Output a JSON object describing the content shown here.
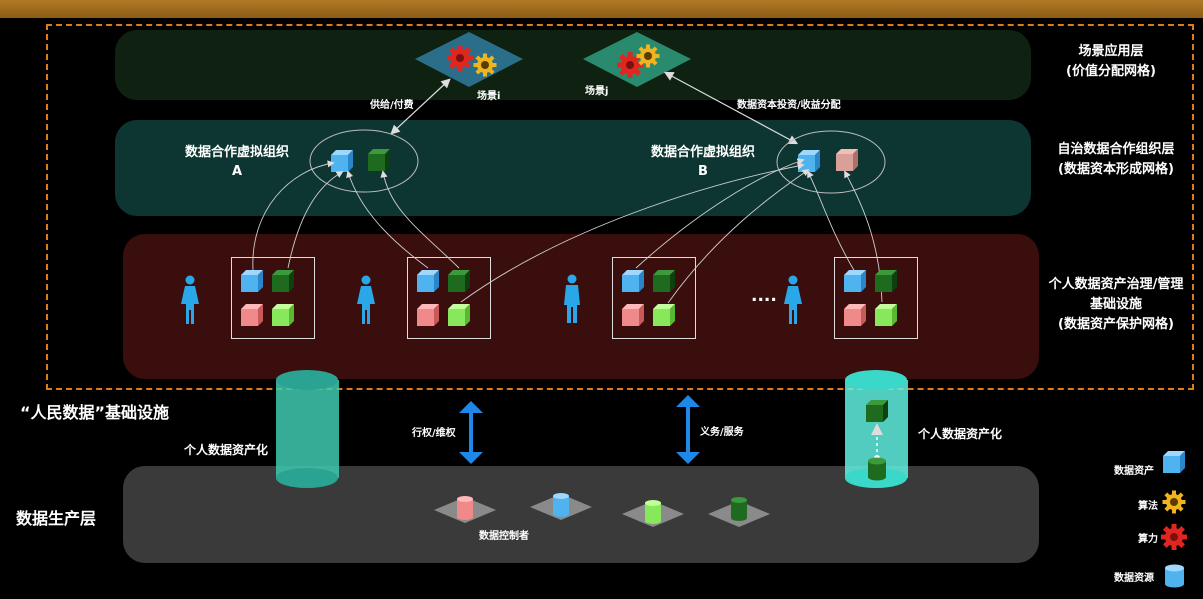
{
  "layers": {
    "scene": {
      "line1": "场景应用层",
      "line2": "(价值分配网格)"
    },
    "org": {
      "line1": "自治数据合作组织层",
      "line2": "(数据资本形成网格)"
    },
    "infra": {
      "line1": "个人数据资产治理/管理",
      "line2": "基础设施",
      "line3": "(数据资产保护网格)"
    }
  },
  "scenes": {
    "scene_i": "场景i",
    "scene_j": "场景j"
  },
  "org_a": {
    "line1": "数据合作虚拟组织",
    "line2": "A"
  },
  "org_b": {
    "line1": "数据合作虚拟组织",
    "line2": "B"
  },
  "flows": {
    "supply_pay": "供给/付费",
    "invest_share": "数据资本投资/收益分配",
    "right_protect": "行权/维权",
    "duty_service": "义务/服务"
  },
  "infra_title": "“人民数据”基础设施",
  "ellipsis": "....",
  "assetization_left": "个人数据资产化",
  "assetization_right": "个人数据资产化",
  "production": {
    "title": "数据生产层",
    "controller": "数据控制者"
  },
  "legend": {
    "data_asset": "数据资产",
    "algorithm": "算法",
    "compute": "算力",
    "data_resource": "数据资源"
  },
  "colors": {
    "frame": "#e07b1a",
    "band_scene": "#0f2212",
    "band_org": "#0d3632",
    "band_infra": "#3b0e0e",
    "band_production": "#3a3a3a",
    "cube_blue": "#4fb3f0",
    "cube_darkgreen": "#1e6b20",
    "cube_pink": "#f08a8a",
    "cube_lightgreen": "#86e85a",
    "gear_red": "#e0261e",
    "gear_gold": "#f0b51e",
    "arrow_blue": "#1e88e8",
    "cylinder_teal": "#40d6b8"
  }
}
